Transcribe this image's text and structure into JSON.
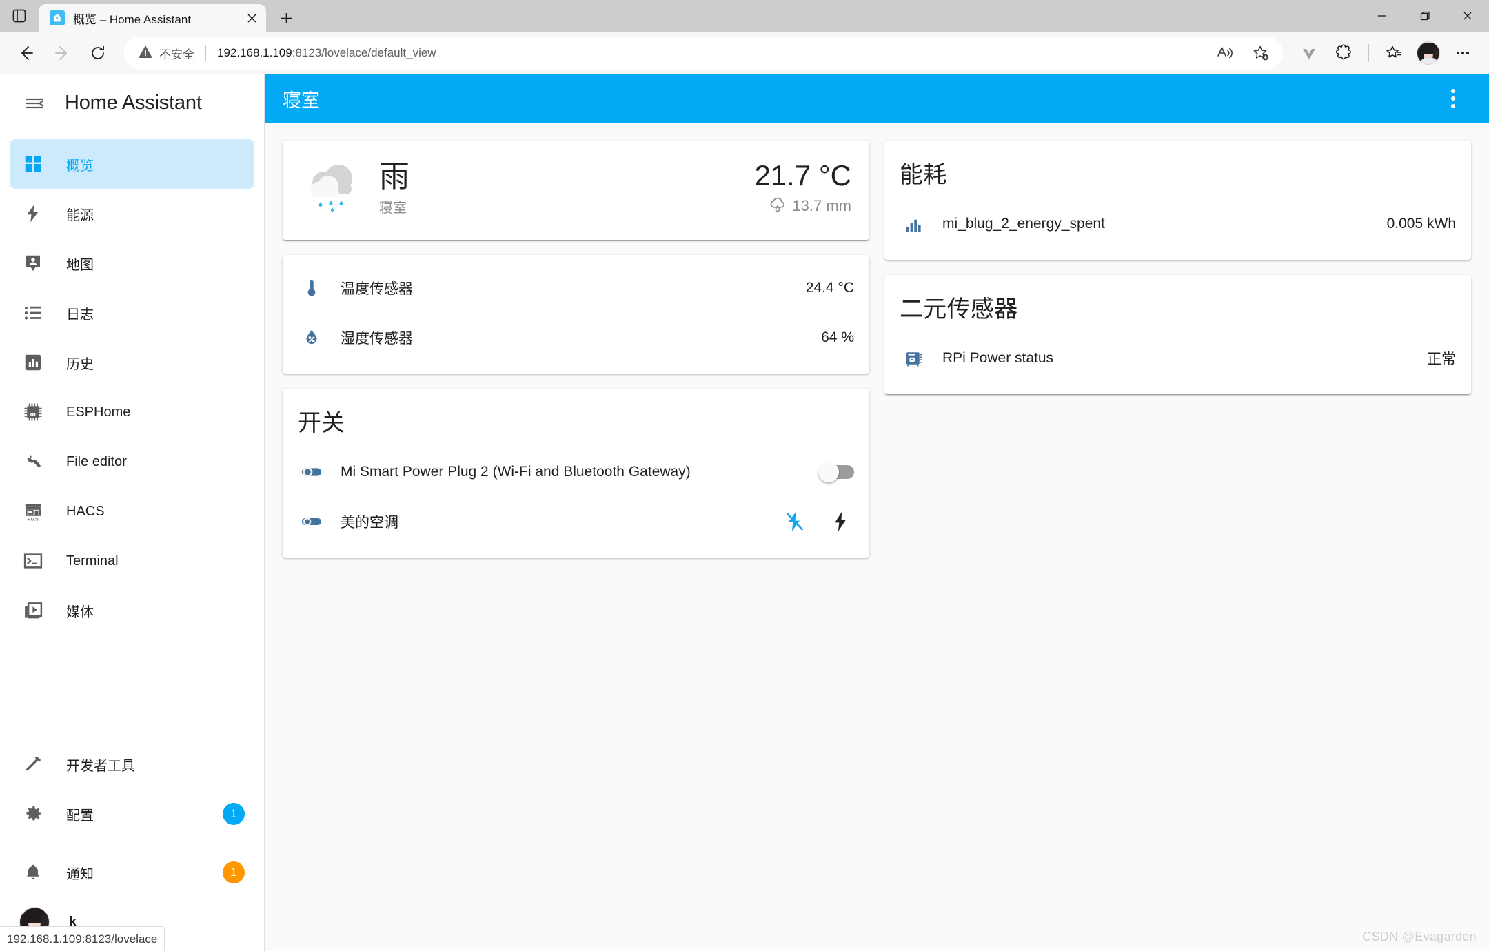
{
  "browser": {
    "tab": {
      "title": "概览 – Home Assistant",
      "favicon": "home-assistant-logo"
    },
    "new_tab_label": "+",
    "window_controls": {
      "minimize": "–",
      "maximize": "❐",
      "close": "✕"
    },
    "omnibox": {
      "security_label": "不安全",
      "url_host": "192.168.1.109",
      "url_path": ":8123/lovelace/default_view"
    }
  },
  "sidebar": {
    "brand": "Home Assistant",
    "items": [
      {
        "label": "概览",
        "icon": "view-dashboard-icon",
        "active": true,
        "badge": ""
      },
      {
        "label": "能源",
        "icon": "lightning-bolt-icon",
        "active": false,
        "badge": ""
      },
      {
        "label": "地图",
        "icon": "map-marker-account-icon",
        "active": false,
        "badge": ""
      },
      {
        "label": "日志",
        "icon": "format-list-bulleted-icon",
        "active": false,
        "badge": ""
      },
      {
        "label": "历史",
        "icon": "chart-box-icon",
        "active": false,
        "badge": ""
      },
      {
        "label": "ESPHome",
        "icon": "chip-icon",
        "active": false,
        "badge": ""
      },
      {
        "label": "File editor",
        "icon": "wrench-icon",
        "active": false,
        "badge": ""
      },
      {
        "label": "HACS",
        "icon": "hacs-storefront-icon",
        "active": false,
        "badge": ""
      },
      {
        "label": "Terminal",
        "icon": "console-icon",
        "active": false,
        "badge": ""
      },
      {
        "label": "媒体",
        "icon": "play-box-multiple-icon",
        "active": false,
        "badge": ""
      }
    ],
    "bottom_items": [
      {
        "label": "开发者工具",
        "icon": "hammer-icon",
        "badge": "",
        "badge_color": ""
      },
      {
        "label": "配置",
        "icon": "cog-icon",
        "badge": "1",
        "badge_color": "#03a9f4"
      }
    ],
    "notifications": {
      "label": "通知",
      "icon": "bell-icon",
      "badge": "1",
      "badge_color": "#ff9800"
    },
    "user": {
      "name": "k",
      "avatar": "user-avatar"
    },
    "status_bubble": "192.168.1.109:8123/lovelace"
  },
  "appbar": {
    "title": "寝室",
    "menu_icon": "dots-vertical-icon"
  },
  "cards": {
    "weather": {
      "icon": "weather-rainy-icon",
      "state": "雨",
      "location": "寝室",
      "temperature": "21.7 °C",
      "precipitation_icon": "weather-pouring-icon",
      "precipitation": "13.7 mm"
    },
    "sensors": {
      "rows": [
        {
          "icon": "thermometer-icon",
          "name": "温度传感器",
          "value": "24.4 °C"
        },
        {
          "icon": "water-percent-icon",
          "name": "湿度传感器",
          "value": "64 %"
        }
      ]
    },
    "switches": {
      "title": "开关",
      "rows": [
        {
          "icon": "toggle-switch-on-icon",
          "name": "Mi Smart Power Plug 2 (Wi-Fi and Bluetooth Gateway)",
          "control": "toggle",
          "toggle_on": false
        },
        {
          "icon": "toggle-switch-off-icon",
          "name": "美的空调",
          "control": "actions",
          "actions": [
            {
              "icon": "flash-off-icon",
              "color": "#12a4ed"
            },
            {
              "icon": "flash-icon",
              "color": "#212121"
            }
          ]
        }
      ]
    },
    "energy": {
      "title": "能耗",
      "rows": [
        {
          "icon": "chart-bar-icon",
          "name": "mi_blug_2_energy_spent",
          "value": "0.005 kWh"
        }
      ]
    },
    "binary_sensor": {
      "title": "二元传感器",
      "rows": [
        {
          "icon": "raspberry-pi-chip-icon",
          "name": "RPi Power status",
          "value": "正常"
        }
      ]
    }
  },
  "watermark": "CSDN @Evagarden",
  "colors": {
    "accent": "#03a9f4",
    "accent_selected_bg": "#cdeafc",
    "badge_orange": "#ff9800",
    "text_primary": "#212121",
    "text_secondary": "#8c8c8c"
  }
}
